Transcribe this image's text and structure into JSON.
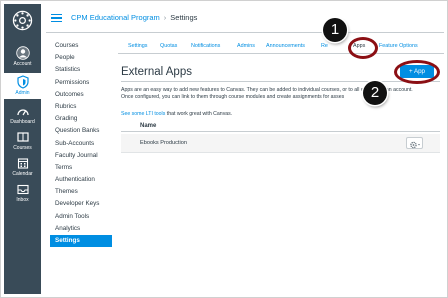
{
  "global_nav": {
    "items": [
      {
        "label": "Account",
        "icon": "account-icon"
      },
      {
        "label": "Admin",
        "icon": "shield-icon",
        "active": true
      },
      {
        "label": "Dashboard",
        "icon": "dashboard-icon"
      },
      {
        "label": "Courses",
        "icon": "courses-icon"
      },
      {
        "label": "Calendar",
        "icon": "calendar-icon"
      },
      {
        "label": "Inbox",
        "icon": "inbox-icon"
      }
    ]
  },
  "header": {
    "account_name": "CPM Educational Program",
    "separator": "›",
    "current_page": "Settings"
  },
  "course_nav": {
    "items": [
      "Courses",
      "People",
      "Statistics",
      "Permissions",
      "Outcomes",
      "Rubrics",
      "Grading",
      "Question Banks",
      "Sub-Accounts",
      "Faculty Journal",
      "Terms",
      "Authentication",
      "Themes",
      "Developer Keys",
      "Admin Tools",
      "Analytics",
      "Settings"
    ],
    "active": "Settings"
  },
  "tabs": {
    "items": [
      "Settings",
      "Quotas",
      "Notifications",
      "Admins",
      "Announcements",
      "Re",
      "Apps",
      "Feature Options"
    ],
    "active": "Apps"
  },
  "main": {
    "title": "External Apps",
    "add_button": "+ App",
    "description_line1": "Apps are an easy way to add new features to Canvas. They can be added to individual courses, or to all courses in an account.",
    "description_line2": "Once configured, you can link to them through course modules and create assignments for asses",
    "see_link": "See some LTI tools",
    "see_suffix": " that work great with Canvas.",
    "table_header_name": "Name",
    "apps": [
      {
        "name": "Ebooks Production"
      }
    ]
  },
  "callouts": {
    "one": "1",
    "two": "2"
  },
  "colors": {
    "nav_bg": "#394B58",
    "accent": "#008EE2",
    "callout_ring": "#8B0F14"
  }
}
